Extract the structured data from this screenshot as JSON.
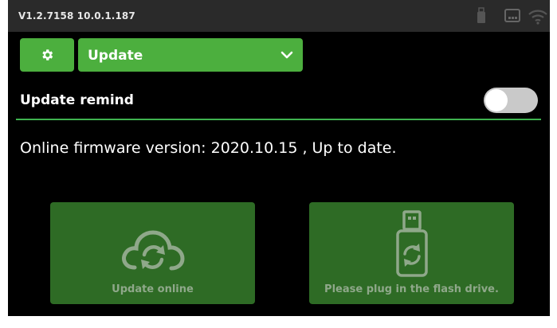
{
  "status_bar": {
    "version_ip": "V1.2.7158  10.0.1.187",
    "icons": [
      "usb-drive-icon",
      "ethernet-icon",
      "wifi-icon"
    ]
  },
  "toolbar": {
    "settings_icon": "gear-icon",
    "dropdown_value": "Update",
    "dropdown_icon": "chevron-down-icon"
  },
  "update_remind": {
    "label": "Update remind",
    "enabled": false
  },
  "firmware": {
    "status_text": "Online firmware version: 2020.10.15 , Up to date."
  },
  "actions": {
    "online": {
      "label": "Update online",
      "icon": "cloud-sync-icon"
    },
    "usb": {
      "label": "Please plug in the flash drive.",
      "icon": "usb-sync-icon"
    }
  },
  "colors": {
    "accent": "#4caf3e",
    "divider": "#3fb34f",
    "disabled_button": "#2e6b25",
    "background": "#000000",
    "status_bar": "#2a2a2a"
  }
}
